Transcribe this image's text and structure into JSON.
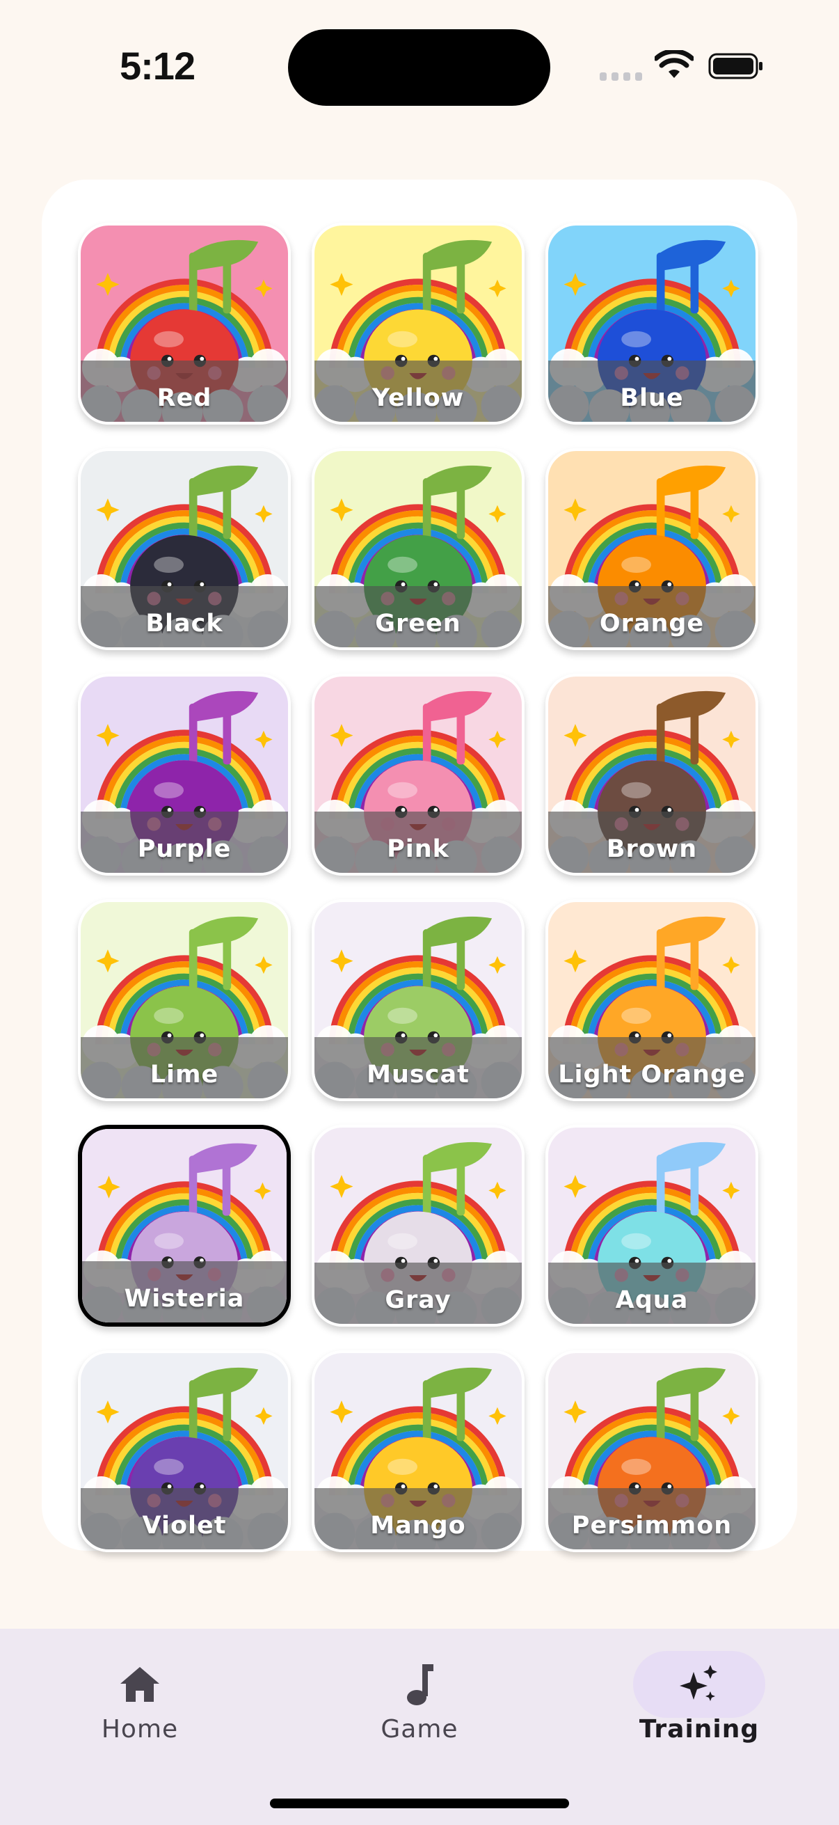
{
  "status_bar": {
    "time": "5:12"
  },
  "tiles": [
    {
      "label": "Red",
      "bg": "#F48FB1",
      "fruit": "#E53935",
      "note": "#7CB342"
    },
    {
      "label": "Yellow",
      "bg": "#FFF59D",
      "fruit": "#FDD835",
      "note": "#7CB342"
    },
    {
      "label": "Blue",
      "bg": "#81D4FA",
      "fruit": "#1E4FD8",
      "note": "#1E63D9"
    },
    {
      "label": "Black",
      "bg": "#ECEFF1",
      "fruit": "#2B2B3A",
      "note": "#7CB342"
    },
    {
      "label": "Green",
      "bg": "#F1F8C8",
      "fruit": "#43A047",
      "note": "#7CB342"
    },
    {
      "label": "Orange",
      "bg": "#FFE0B2",
      "fruit": "#FB8C00",
      "note": "#FFA000"
    },
    {
      "label": "Purple",
      "bg": "#E8DAF5",
      "fruit": "#8E24AA",
      "note": "#AB47BC"
    },
    {
      "label": "Pink",
      "bg": "#F8D7E3",
      "fruit": "#F48FB1",
      "note": "#F06292"
    },
    {
      "label": "Brown",
      "bg": "#FCE4D6",
      "fruit": "#6D4C41",
      "note": "#8D5A2B"
    },
    {
      "label": "Lime",
      "bg": "#F0F8D8",
      "fruit": "#8BC34A",
      "note": "#8BC34A"
    },
    {
      "label": "Muscat",
      "bg": "#F3EEF7",
      "fruit": "#9CCC65",
      "note": "#7CB342"
    },
    {
      "label": "Light Orange",
      "bg": "#FFE8D2",
      "fruit": "#FFA726",
      "note": "#FFA726"
    },
    {
      "label": "Wisteria",
      "bg": "#EFE3F5",
      "fruit": "#C9A6DD",
      "note": "#B073D4",
      "selected": true
    },
    {
      "label": "Gray",
      "bg": "#F2EAF5",
      "fruit": "#E6DDE8",
      "note": "#8BC34A"
    },
    {
      "label": "Aqua",
      "bg": "#F2E8F5",
      "fruit": "#7EE0E6",
      "note": "#90CAF9"
    },
    {
      "label": "Violet",
      "bg": "#EEF0F5",
      "fruit": "#6A3FB0",
      "note": "#7CB342"
    },
    {
      "label": "Mango",
      "bg": "#F1EEF6",
      "fruit": "#FFC928",
      "note": "#7CB342"
    },
    {
      "label": "Persimmon",
      "bg": "#F3EDF3",
      "fruit": "#F4701E",
      "note": "#7CB342"
    }
  ],
  "nav": {
    "items": [
      {
        "label": "Home",
        "icon": "home-icon"
      },
      {
        "label": "Game",
        "icon": "music-note-icon"
      },
      {
        "label": "Training",
        "icon": "sparkles-icon",
        "active": true
      }
    ]
  }
}
